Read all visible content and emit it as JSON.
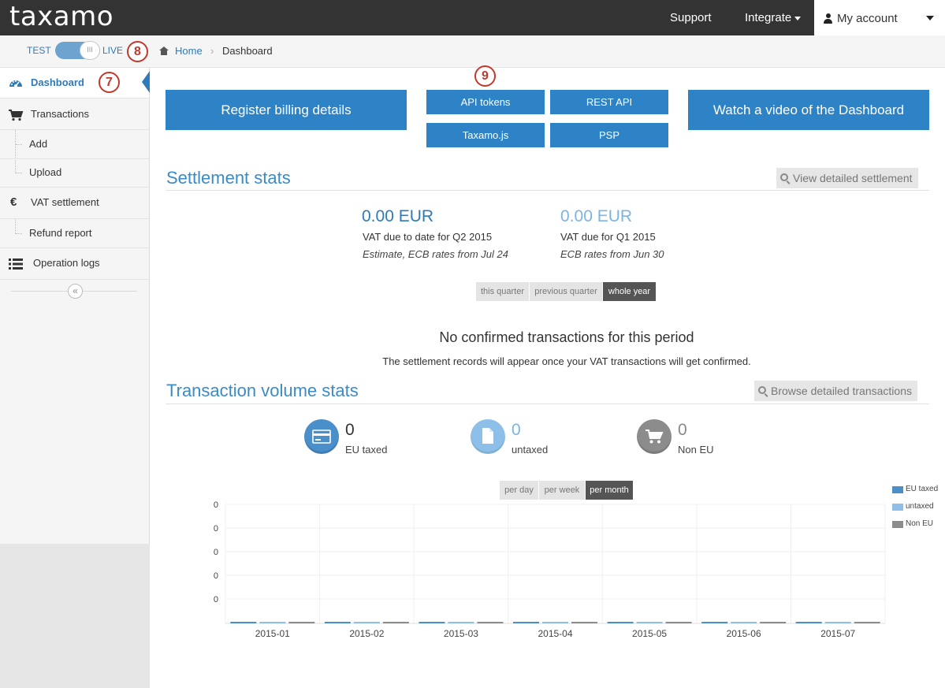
{
  "app": {
    "logo": "taxamo"
  },
  "topnav": {
    "support": "Support",
    "integrate": "Integrate",
    "account": "My account"
  },
  "mode": {
    "test": "TEST",
    "live": "LIVE",
    "knob": "III"
  },
  "annotations": {
    "a7": "7",
    "a8": "8",
    "a9": "9"
  },
  "breadcrumb": {
    "home": "Home",
    "separator": ">",
    "current": "Dashboard"
  },
  "sidebar": {
    "items": [
      {
        "label": "Dashboard",
        "icon": "dashboard-gauge-icon"
      },
      {
        "label": "Transactions",
        "icon": "cart-icon"
      },
      {
        "label": "Add"
      },
      {
        "label": "Upload"
      },
      {
        "label": "VAT settlement",
        "icon": "euro-icon"
      },
      {
        "label": "Refund report"
      },
      {
        "label": "Operation logs",
        "icon": "list-icon"
      }
    ],
    "collapse": "«"
  },
  "actions": {
    "register": "Register billing details",
    "api_tokens": "API tokens",
    "rest_api": "REST API",
    "taxamo_js": "Taxamo.js",
    "psp": "PSP",
    "video": "Watch a video of the Dashboard"
  },
  "settlement": {
    "title": "Settlement stats",
    "view_button": "View detailed settlement",
    "q2": {
      "amount": "0.00 EUR",
      "label": "VAT due to date for Q2 2015",
      "note": "Estimate, ECB rates from Jul 24"
    },
    "q1": {
      "amount": "0.00 EUR",
      "label": "VAT due for Q1 2015",
      "note": "ECB rates from Jun 30"
    },
    "periods": [
      "this quarter",
      "previous quarter",
      "whole year"
    ],
    "active_period": "whole year",
    "empty_title": "No confirmed transactions for this period",
    "empty_message": "The settlement records will appear once your VAT transactions will get confirmed."
  },
  "volume": {
    "title": "Transaction volume stats",
    "browse_button": "Browse detailed transactions",
    "stats": [
      {
        "count": "0",
        "label": "EU taxed",
        "icon": "credit-card-icon"
      },
      {
        "count": "0",
        "label": "untaxed",
        "icon": "document-icon"
      },
      {
        "count": "0",
        "label": "Non EU",
        "icon": "cart-icon"
      }
    ],
    "granularity": [
      "per day",
      "per week",
      "per month"
    ],
    "active_granularity": "per month"
  },
  "colors": {
    "eu_taxed": "#4a8fca",
    "untaxed": "#8dbfe8",
    "non_eu": "#8c8c8c",
    "accent": "#2e83c6"
  },
  "chart_data": {
    "type": "bar",
    "categories": [
      "2015-01",
      "2015-02",
      "2015-03",
      "2015-04",
      "2015-05",
      "2015-06",
      "2015-07"
    ],
    "series": [
      {
        "name": "EU taxed",
        "values": [
          0,
          0,
          0,
          0,
          0,
          0,
          0
        ]
      },
      {
        "name": "untaxed",
        "values": [
          0,
          0,
          0,
          0,
          0,
          0,
          0
        ]
      },
      {
        "name": "Non EU",
        "values": [
          0,
          0,
          0,
          0,
          0,
          0,
          0
        ]
      }
    ],
    "y_ticks": [
      "0",
      "0",
      "0",
      "0",
      "0"
    ],
    "ylim": [
      0,
      1
    ],
    "grid": true,
    "legend": "right"
  }
}
